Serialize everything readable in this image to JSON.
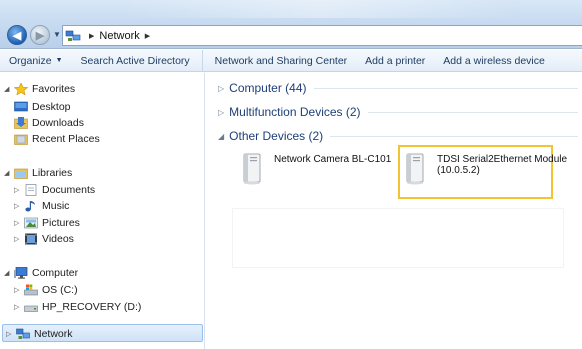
{
  "window": {
    "location": "Network"
  },
  "toolbar": {
    "organize": "Organize",
    "search_ad": "Search Active Directory",
    "sharing_center": "Network and Sharing Center",
    "add_printer": "Add a printer",
    "add_wireless": "Add a wireless device"
  },
  "nav": {
    "favorites": "Favorites",
    "desktop": "Desktop",
    "downloads": "Downloads",
    "recent": "Recent Places",
    "libraries": "Libraries",
    "documents": "Documents",
    "music": "Music",
    "pictures": "Pictures",
    "videos": "Videos",
    "computer": "Computer",
    "os_drive": "OS (C:)",
    "recovery_drive": "HP_RECOVERY (D:)",
    "network": "Network"
  },
  "groups": {
    "computer": "Computer (44)",
    "multifunction": "Multifunction Devices (2)",
    "other": "Other Devices (2)"
  },
  "devices": {
    "camera": "Network Camera BL-C101",
    "module_line1": "TDSI Serial2Ethernet Module",
    "module_line2": "(10.0.5.2)"
  },
  "colors": {
    "highlight": "#f2c431",
    "group_text": "#1e3f78",
    "selection": "#cfe2f7"
  }
}
